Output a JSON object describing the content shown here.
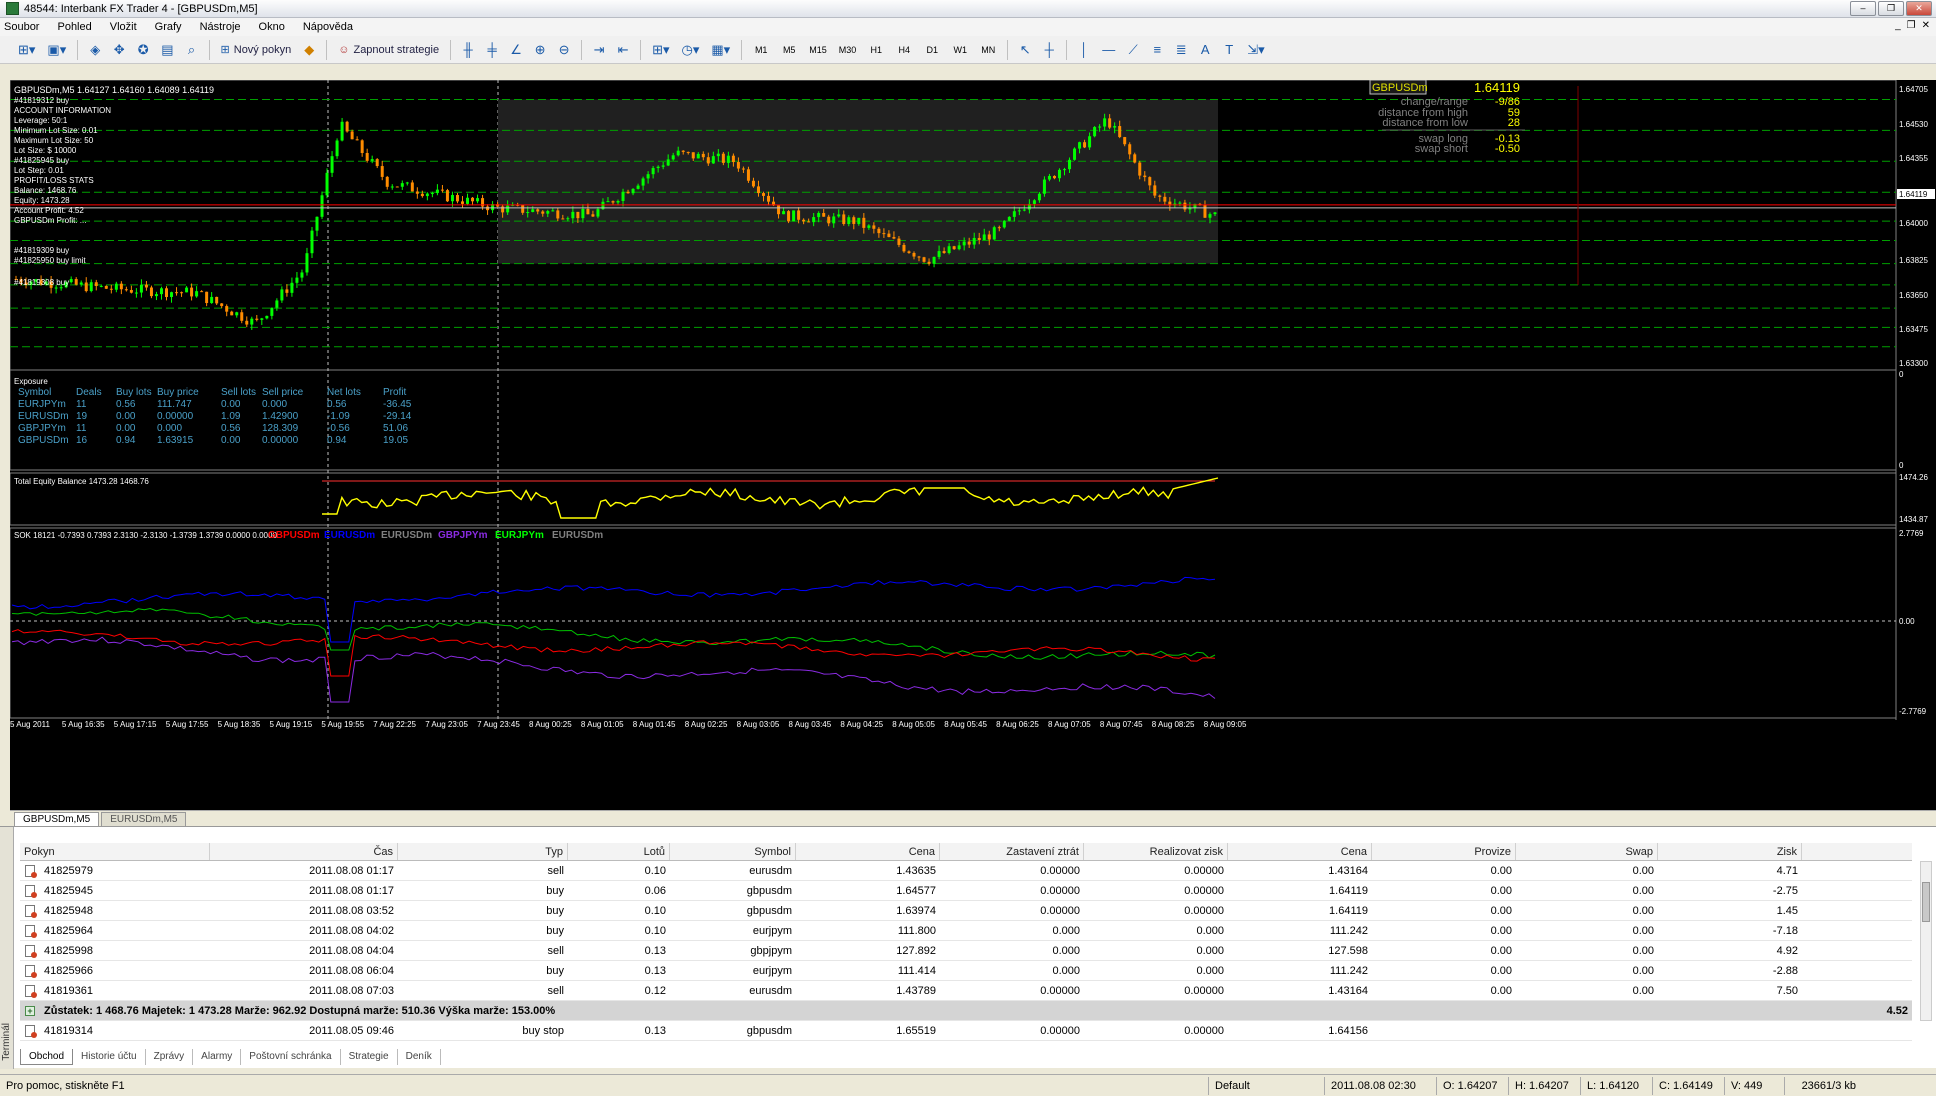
{
  "window": {
    "title": "48544: Interbank FX Trader 4 - [GBPUSDm,M5]"
  },
  "menu": [
    "Soubor",
    "Pohled",
    "Vložit",
    "Grafy",
    "Nástroje",
    "Okno",
    "Nápověda"
  ],
  "toolbar": {
    "new_order": "Nový pokyn",
    "strategies": "Zapnout strategie",
    "timeframes": [
      "M1",
      "M5",
      "M15",
      "M30",
      "H1",
      "H4",
      "D1",
      "W1",
      "MN"
    ]
  },
  "chart": {
    "header": "GBPUSDm,M5  1.64127 1.64160 1.64089 1.64119",
    "price_axis": [
      "1.64705",
      "1.64530",
      "1.64355",
      "1.64119",
      "1.64000",
      "1.63825",
      "1.63650",
      "1.63475",
      "1.63300"
    ],
    "info_lines": [
      "#41819312 buy",
      "ACCOUNT INFORMATION",
      "Leverage: 50:1",
      "Minimum Lot Size: 0.01",
      "Maximum Lot Size: 50",
      "Lot Size: $ 10000",
      "#41825945 buy",
      "Lot Step: 0.01",
      "PROFIT/LOSS STATS",
      "Balance: 1468.76",
      "Equity: 1473.28",
      "Account Profit: 4.52",
      "GBPUSDm Profit: ...",
      "#41819309 buy",
      "#41825950 buy limit",
      "#41819308 buy"
    ],
    "symbol_box": {
      "symbol": "GBPUSDm",
      "price": "1.64119"
    },
    "stats": [
      {
        "label": "change/range",
        "value": "-9/86"
      },
      {
        "label": "distance from high",
        "value": "59"
      },
      {
        "label": "distance from low",
        "value": "28"
      },
      {
        "label": "swap long",
        "value": "-0.13"
      },
      {
        "label": "swap short",
        "value": "-0.50"
      }
    ],
    "exposure": {
      "title": "Exposure",
      "headers": [
        "Symbol",
        "Deals",
        "Buy lots",
        "Buy price",
        "Sell lots",
        "Sell price",
        "Net lots",
        "Profit"
      ],
      "rows": [
        [
          "EURJPYm",
          "11",
          "0.56",
          "111.747",
          "0.00",
          "0.000",
          "0.56",
          "-36.45"
        ],
        [
          "EURUSDm",
          "19",
          "0.00",
          "0.00000",
          "1.09",
          "1.42900",
          "-1.09",
          "-29.14"
        ],
        [
          "GBPJPYm",
          "11",
          "0.00",
          "0.000",
          "0.56",
          "128.309",
          "-0.56",
          "51.06"
        ],
        [
          "GBPUSDm",
          "16",
          "0.94",
          "1.63915",
          "0.00",
          "0.00000",
          "0.94",
          "19.05"
        ]
      ],
      "axis": [
        "0",
        "0"
      ]
    },
    "equity": {
      "label": "Total Equity Balance 1473.28 1468.76",
      "axis": [
        "1474.26",
        "1434.87"
      ]
    },
    "sok": {
      "label": "SOK 18121 -0.7393 0.7393 2.3130 -2.3130 -1.3739 1.3739 0.0000 0.0000",
      "series": [
        {
          "name": "GBPUSDm",
          "color": "#ff0000"
        },
        {
          "name": "EURUSDm",
          "color": "#0000ff"
        },
        {
          "name": "EURUSDm",
          "color": "#808080"
        },
        {
          "name": "GBPJPYm",
          "color": "#8a2be2"
        },
        {
          "name": "EURJPYm",
          "color": "#00ff00"
        },
        {
          "name": "EURUSDm",
          "color": "#808080"
        }
      ],
      "axis": [
        "2.7769",
        "0.00",
        "-2.7769"
      ]
    },
    "time_axis": [
      "5 Aug 2011",
      "5 Aug 16:35",
      "5 Aug 17:15",
      "5 Aug 17:55",
      "5 Aug 18:35",
      "5 Aug 19:15",
      "5 Aug 19:55",
      "7 Aug 22:25",
      "7 Aug 23:05",
      "7 Aug 23:45",
      "8 Aug 00:25",
      "8 Aug 01:05",
      "8 Aug 01:45",
      "8 Aug 02:25",
      "8 Aug 03:05",
      "8 Aug 03:45",
      "8 Aug 04:25",
      "8 Aug 05:05",
      "8 Aug 05:45",
      "8 Aug 06:25",
      "8 Aug 07:05",
      "8 Aug 07:45",
      "8 Aug 08:25",
      "8 Aug 09:05"
    ],
    "colors": {
      "bull": "#00ff00",
      "bear": "#ff8c00",
      "ask_line": "#ff0000",
      "grid": "#00a000"
    }
  },
  "chart_tabs": [
    "GBPUSDm,M5",
    "EURUSDm,M5"
  ],
  "terminal": {
    "side_label": "Terminál",
    "headers": [
      "Pokyn",
      "Čas",
      "Typ",
      "Lotů",
      "Symbol",
      "Cena",
      "Zastavení ztrát",
      "Realizovat zisk",
      "Cena",
      "Provize",
      "Swap",
      "Zisk"
    ],
    "rows": [
      [
        "41825979",
        "2011.08.08 01:17",
        "sell",
        "0.10",
        "eurusdm",
        "1.43635",
        "0.00000",
        "0.00000",
        "1.43164",
        "0.00",
        "0.00",
        "4.71"
      ],
      [
        "41825945",
        "2011.08.08 01:17",
        "buy",
        "0.06",
        "gbpusdm",
        "1.64577",
        "0.00000",
        "0.00000",
        "1.64119",
        "0.00",
        "0.00",
        "-2.75"
      ],
      [
        "41825948",
        "2011.08.08 03:52",
        "buy",
        "0.10",
        "gbpusdm",
        "1.63974",
        "0.00000",
        "0.00000",
        "1.64119",
        "0.00",
        "0.00",
        "1.45"
      ],
      [
        "41825964",
        "2011.08.08 04:02",
        "buy",
        "0.10",
        "eurjpym",
        "111.800",
        "0.000",
        "0.000",
        "111.242",
        "0.00",
        "0.00",
        "-7.18"
      ],
      [
        "41825998",
        "2011.08.08 04:04",
        "sell",
        "0.13",
        "gbpjpym",
        "127.892",
        "0.000",
        "0.000",
        "127.598",
        "0.00",
        "0.00",
        "4.92"
      ],
      [
        "41825966",
        "2011.08.08 06:04",
        "buy",
        "0.13",
        "eurjpym",
        "111.414",
        "0.000",
        "0.000",
        "111.242",
        "0.00",
        "0.00",
        "-2.88"
      ],
      [
        "41819361",
        "2011.08.08 07:03",
        "sell",
        "0.12",
        "eurusdm",
        "1.43789",
        "0.00000",
        "0.00000",
        "1.43164",
        "0.00",
        "0.00",
        "7.50"
      ]
    ],
    "summary": {
      "text": "Zůstatek: 1 468.76  Majetek: 1 473.28  Marže: 962.92  Dostupná marže: 510.36  Výška marže: 153.00%",
      "profit": "4.52"
    },
    "pending": [
      [
        "41819314",
        "2011.08.05 09:46",
        "buy stop",
        "0.13",
        "gbpusdm",
        "1.65519",
        "0.00000",
        "0.00000",
        "1.64156",
        "",
        "",
        ""
      ]
    ],
    "tabs": [
      "Obchod",
      "Historie účtu",
      "Zprávy",
      "Alarmy",
      "Poštovní schránka",
      "Strategie",
      "Deník"
    ]
  },
  "status": {
    "help": "Pro pomoc, stiskněte F1",
    "profile": "Default",
    "time": "2011.08.08 02:30",
    "open": "O: 1.64207",
    "high": "H: 1.64207",
    "low": "L: 1.64120",
    "close": "C: 1.64149",
    "volume": "V: 449",
    "traffic": "23661/3 kb"
  }
}
